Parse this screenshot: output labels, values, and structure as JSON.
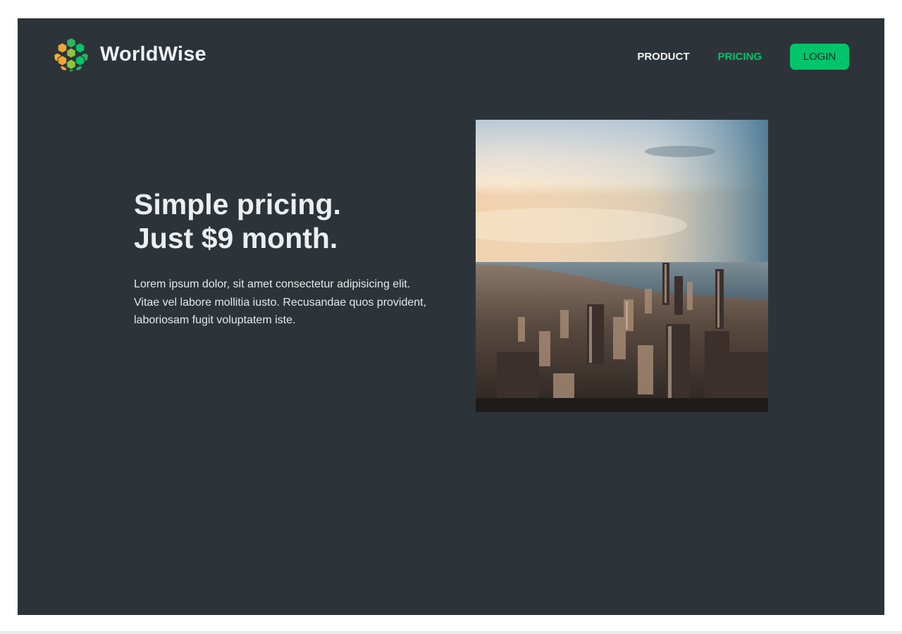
{
  "brand": {
    "name": "WorldWise",
    "logo_icon": "globe-hex-logo-icon"
  },
  "nav": {
    "product": "PRODUCT",
    "pricing": "PRICING",
    "login": "LOGIN",
    "active": "pricing"
  },
  "hero": {
    "title_line1": "Simple pricing.",
    "title_line2": "Just $9 month.",
    "text": "Lorem ipsum dolor, sit amet consectetur adipisicing elit. Vitae vel labore mollitia iusto. Recusandae quos provident, laboriosam fugit voluptatem iste.",
    "image": "city-skyline-image"
  },
  "colors": {
    "background": "#2d3439",
    "accent": "#00c46a",
    "text": "#f1f3f5"
  }
}
